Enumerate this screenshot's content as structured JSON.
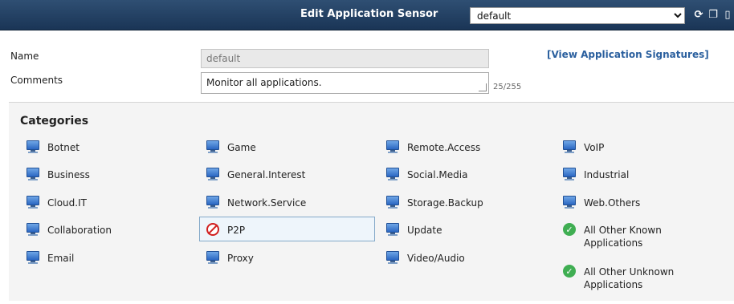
{
  "header": {
    "title": "Edit Application Sensor",
    "profile_select": "default"
  },
  "form": {
    "name_label": "Name",
    "name_value": "default",
    "comments_label": "Comments",
    "comments_value": "Monitor all applications.",
    "comments_count": "25/255",
    "view_signatures_link": "[View Application Signatures]"
  },
  "categories": {
    "title": "Categories",
    "items": [
      {
        "label": "Botnet",
        "icon": "monitor-icon"
      },
      {
        "label": "Business",
        "icon": "monitor-icon"
      },
      {
        "label": "Cloud.IT",
        "icon": "monitor-icon"
      },
      {
        "label": "Collaboration",
        "icon": "monitor-icon"
      },
      {
        "label": "Email",
        "icon": "monitor-icon"
      },
      {
        "label": "Game",
        "icon": "monitor-icon"
      },
      {
        "label": "General.Interest",
        "icon": "monitor-icon"
      },
      {
        "label": "Network.Service",
        "icon": "monitor-icon"
      },
      {
        "label": "P2P",
        "icon": "block-icon",
        "selected": true
      },
      {
        "label": "Proxy",
        "icon": "monitor-icon"
      },
      {
        "label": "Remote.Access",
        "icon": "monitor-icon"
      },
      {
        "label": "Social.Media",
        "icon": "monitor-icon"
      },
      {
        "label": "Storage.Backup",
        "icon": "monitor-icon"
      },
      {
        "label": "Update",
        "icon": "monitor-icon"
      },
      {
        "label": "Video/Audio",
        "icon": "monitor-icon"
      },
      {
        "label": "VoIP",
        "icon": "monitor-icon"
      },
      {
        "label": "Industrial",
        "icon": "monitor-icon"
      },
      {
        "label": "Web.Others",
        "icon": "monitor-icon"
      },
      {
        "label": "All Other Known Applications",
        "icon": "check-icon"
      },
      {
        "label": "All Other Unknown Applications",
        "icon": "check-icon"
      }
    ]
  },
  "colors": {
    "header_bg": "#1f3b5e",
    "link": "#2a5f9e",
    "selected_border": "#84a9c9",
    "allow_green": "#3fae52",
    "block_red": "#d11f1f"
  }
}
